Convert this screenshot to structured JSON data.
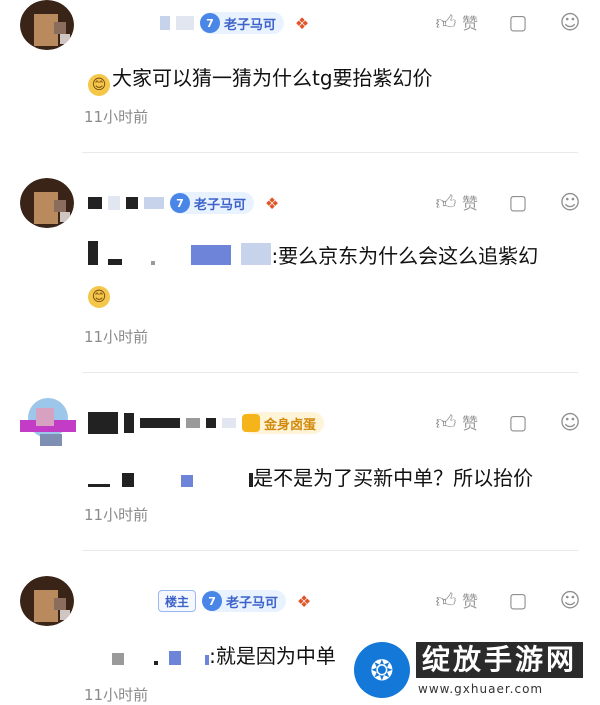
{
  "badges": {
    "level": "7",
    "title": "老子马可",
    "gold": "金身卤蛋",
    "host": "楼主"
  },
  "actions": {
    "like_label": "赞"
  },
  "posts": [
    {
      "text": "大家可以猜一猜为什么tg要抬紫幻价",
      "time": "11小时前"
    },
    {
      "text": ":要么京东为什么会这么追紫幻",
      "time": "11小时前"
    },
    {
      "text": "是不是为了买新中单？所以抬价",
      "time": "11小时前"
    },
    {
      "text": ":就是因为中单",
      "time": "11小时前"
    }
  ],
  "watermark": {
    "title": "绽放手游网",
    "url": "www.gxhuaer.com"
  },
  "icons": [
    "thumb-up-icon",
    "comment-icon",
    "more-icon",
    "emoji-icon",
    "shield-icon",
    "ornament-icon"
  ]
}
